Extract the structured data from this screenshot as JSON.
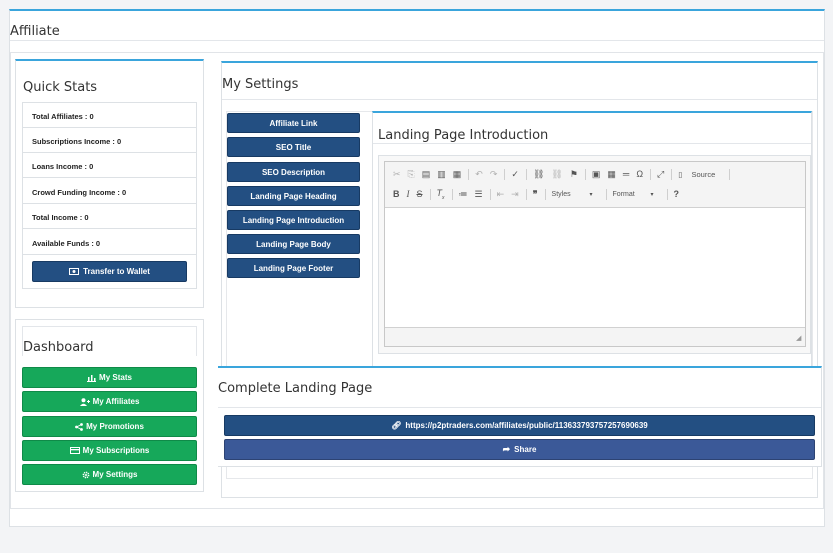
{
  "page_title": "Affiliate",
  "quick_stats": {
    "title": "Quick Stats",
    "rows": [
      "Total Affiliates : 0",
      "Subscriptions Income : 0",
      "Loans Income : 0",
      "Crowd Funding Income : 0",
      "Total Income : 0",
      "Available Funds : 0"
    ],
    "transfer_label": "Transfer to Wallet"
  },
  "dashboard": {
    "title": "Dashboard",
    "items": [
      "My Stats",
      "My Affiliates",
      "My Promotions",
      "My Subscriptions",
      "My Settings"
    ]
  },
  "settings": {
    "title": "My Settings",
    "tabs": [
      "Affiliate Link",
      "SEO Title",
      "SEO Description",
      "Landing Page Heading",
      "Landing Page Introduction",
      "Landing Page Body",
      "Landing Page Footer"
    ],
    "editor_title": "Landing Page Introduction",
    "toolbar": {
      "source_label": "Source",
      "styles_label": "Styles",
      "format_label": "Format",
      "help_label": "?"
    }
  },
  "complete": {
    "title": "Complete Landing Page",
    "link": "https://p2ptraders.com/affiliates/public/113633793757257690639",
    "share_label": "Share"
  },
  "colors": {
    "navy": "#234f82",
    "green": "#16a85a",
    "accent": "#3aa5dc",
    "share": "#3b5998"
  }
}
